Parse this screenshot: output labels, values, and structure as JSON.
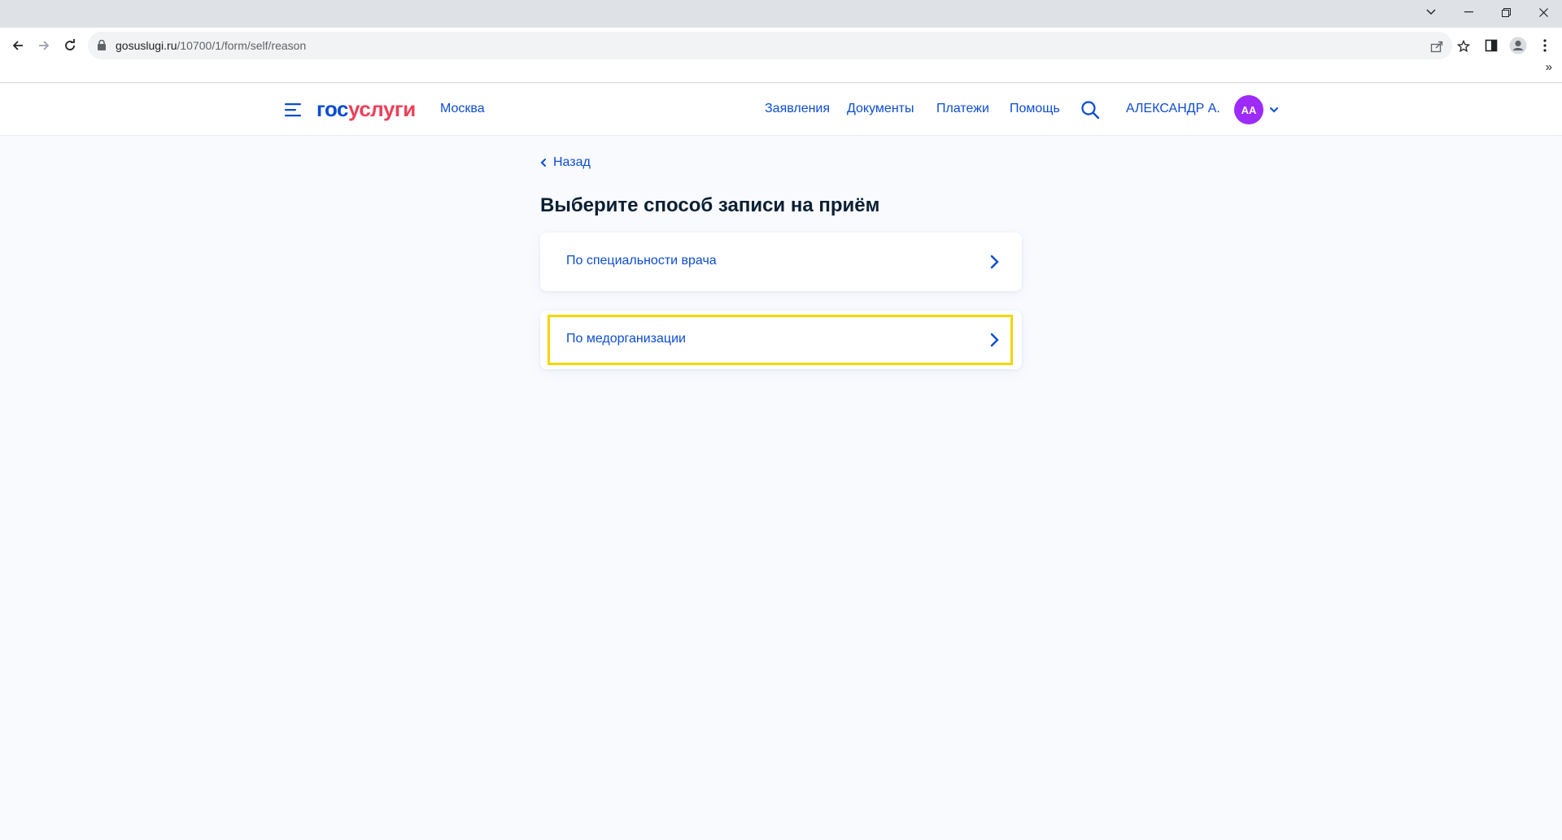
{
  "browser": {
    "url_host": "gosuslugi.ru",
    "url_path": "/10700/1/form/self/reason",
    "overflow_label": "»"
  },
  "header": {
    "logo_part1": "гос",
    "logo_part2": "услуги",
    "city": "Москва",
    "nav": [
      "Заявления",
      "Документы",
      "Платежи",
      "Помощь"
    ],
    "user_name": "АЛЕКСАНДР А.",
    "avatar_initials": "АА",
    "avatar_color": "#9d2bfa"
  },
  "content": {
    "back_label": "Назад",
    "title": "Выберите способ записи на приём",
    "options": [
      {
        "label": "По специальности врача"
      },
      {
        "label": "По медорганизации"
      }
    ]
  },
  "colors": {
    "accent": "#0d4cd3",
    "logo_red": "#ee3f58",
    "highlight": "#f2d600"
  }
}
